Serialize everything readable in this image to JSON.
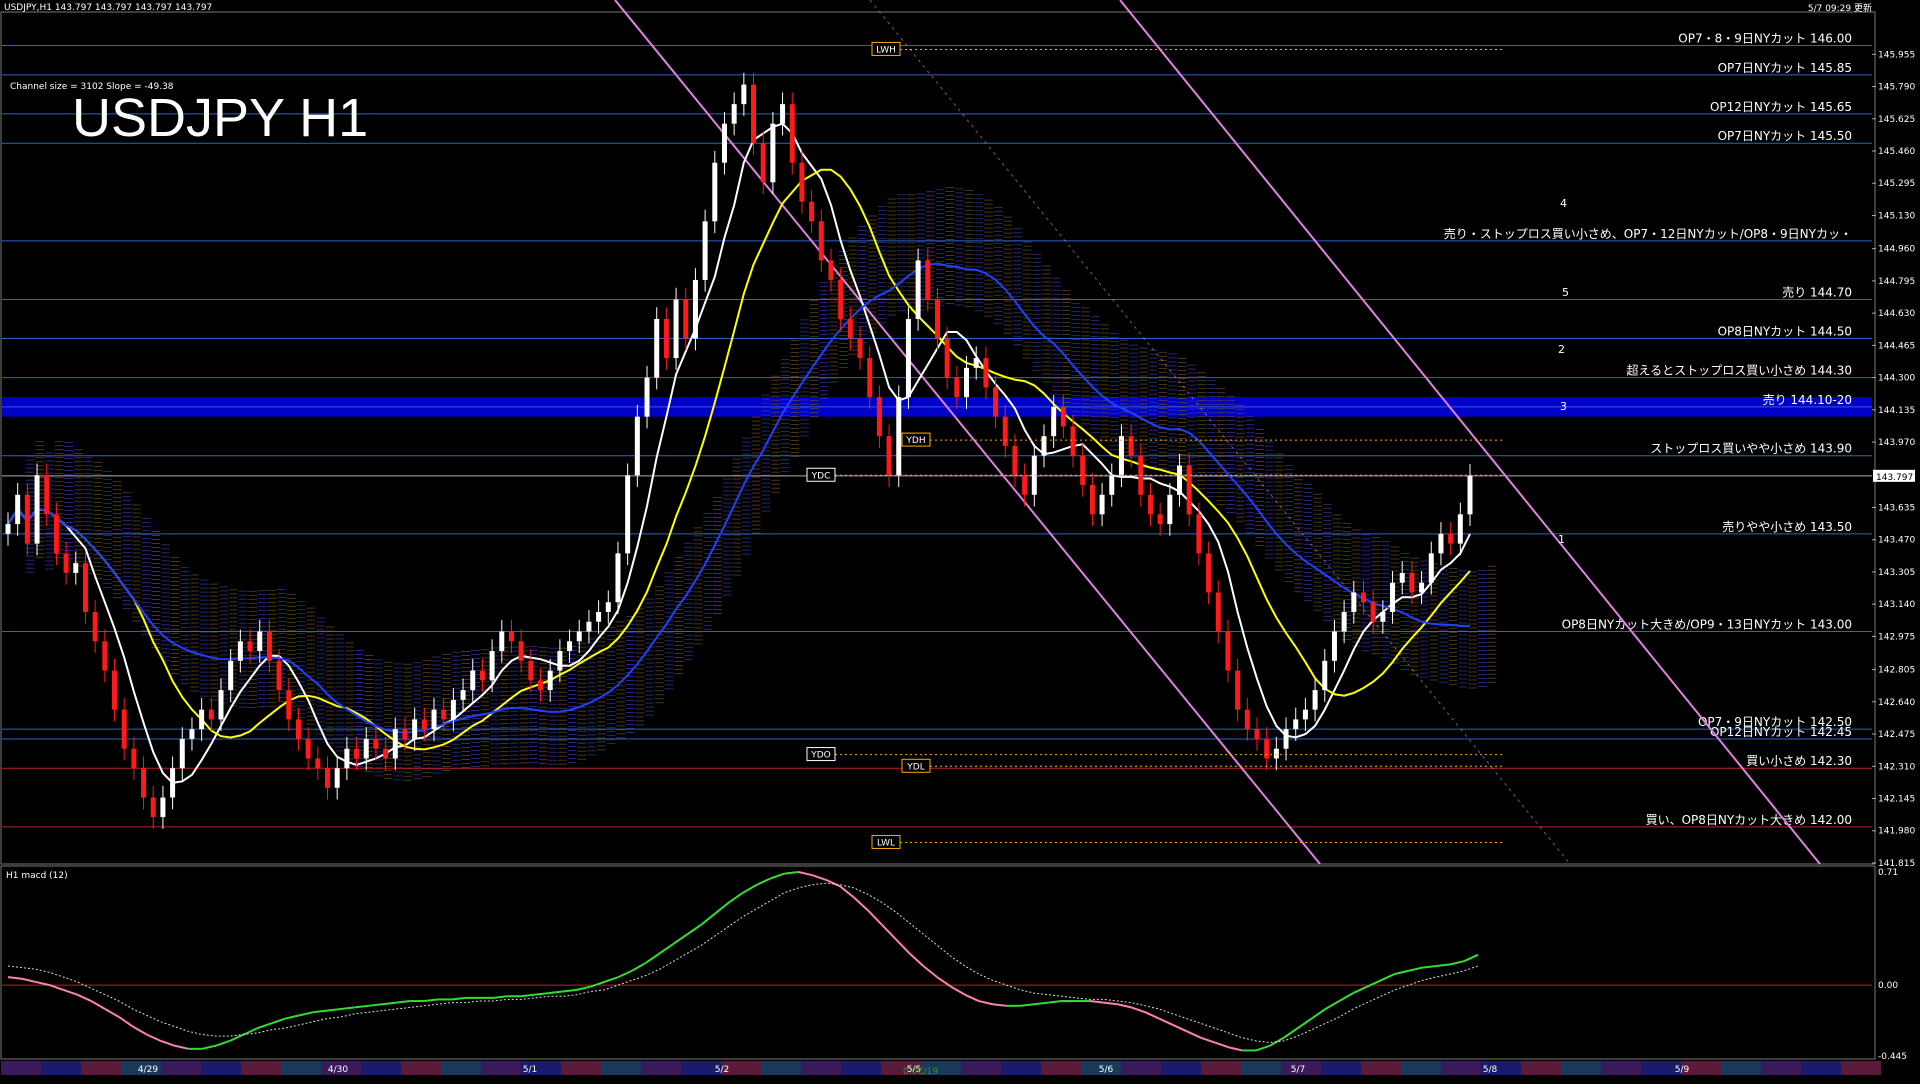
{
  "header": {
    "symbol_line": "USDJPY,H1  143.797 143.797 143.797 143.797",
    "channel_info": "Channel size = 3102 Slope = -49.38",
    "big_title": "USDJPY H1",
    "updated": "5/7 09:29 更新"
  },
  "macd_header": "H1  macd (12)",
  "footer_code": "0.0C/19",
  "colors": {
    "bg": "#000000",
    "grid_h": "#2f5fd0",
    "candle_up": "#ffffff",
    "candle_down": "#ff1a1a",
    "macd_main": "#33dd33",
    "macd_down": "#ff80b0",
    "signal": "#dddddd",
    "zone": "#0000c8",
    "channel": "#e080e0",
    "ma_white": "#ffffff",
    "ma_yellow": "#ffff00",
    "ma_blue": "#2040ff",
    "osc_green": "#22cc22"
  },
  "chart_data": {
    "type": "candlestick",
    "symbol": "USDJPY",
    "timeframe": "H1",
    "ylim": [
      141.82,
      146.1
    ],
    "last_price": "143.797",
    "y_ticks": [
      "145.955",
      "145.790",
      "145.625",
      "145.460",
      "145.295",
      "145.130",
      "144.960",
      "144.795",
      "144.630",
      "144.465",
      "144.300",
      "144.135",
      "143.970",
      "143.635",
      "143.470",
      "143.305",
      "143.140",
      "142.975",
      "142.805",
      "142.640",
      "142.475",
      "142.310",
      "142.145",
      "141.980",
      "141.815"
    ],
    "x_ticks": [
      "4/29",
      "4/30",
      "5/1",
      "5/2",
      "5/5",
      "5/6",
      "5/7",
      "5/8",
      "5/9"
    ],
    "levels": [
      {
        "price": 146.0,
        "label": "OP7・8・9日NYカット 146.00",
        "color": "#2f5fd0"
      },
      {
        "price": 145.85,
        "label": "OP7日NYカット 145.85",
        "color": "#2f5fd0"
      },
      {
        "price": 145.65,
        "label": "OP12日NYカット 145.65",
        "color": "#2f5fd0"
      },
      {
        "price": 145.5,
        "label": "OP7日NYカット 145.50",
        "color": "#2f5fd0"
      },
      {
        "price": 145.0,
        "label": "売り・ストップロス買い小さめ、OP7・12日NYカット/OP8・9日NYカッ・",
        "color": "#2f5fd0"
      },
      {
        "price": 144.7,
        "label": "売り 144.70",
        "color": "#2f5fd0"
      },
      {
        "price": 144.5,
        "label": "OP8日NYカット 144.50",
        "color": "#2f5fd0"
      },
      {
        "price": 144.3,
        "label": "超えるとストップロス買い小さめ 144.30",
        "color": "#2f5fd0"
      },
      {
        "price": 144.15,
        "label": "売り 144.10-20",
        "color": "#2f5fd0"
      },
      {
        "price": 143.9,
        "label": "ストップロス買いやや小さめ 143.90",
        "color": "#2f5fd0"
      },
      {
        "price": 143.5,
        "label": "売りやや小さめ 143.50",
        "color": "#2f5fd0"
      },
      {
        "price": 143.0,
        "label": "OP8日NYカット大きめ/OP9・13日NYカット 143.00",
        "color": "#2f5fd0"
      },
      {
        "price": 142.5,
        "label": "OP7・9日NYカット 142.50",
        "color": "#2f5fd0"
      },
      {
        "price": 142.45,
        "label": "OP12日NYカット 142.45",
        "color": "#2f5fd0"
      },
      {
        "price": 142.3,
        "label": "買い小さめ 142.30",
        "color": "#c02020"
      },
      {
        "price": 142.0,
        "label": "買い、OP8日NYカット大きめ 142.00",
        "color": "#c02020"
      }
    ],
    "markers": [
      {
        "label": "LWH",
        "price": 145.98
      },
      {
        "label": "YDH",
        "price": 143.98
      },
      {
        "label": "YDC",
        "price": 143.8
      },
      {
        "label": "YDO",
        "price": 142.37
      },
      {
        "label": "YDL",
        "price": 142.31
      },
      {
        "label": "LWL",
        "price": 141.92
      }
    ],
    "wave_labels": [
      "1",
      "2",
      "3",
      "4",
      "5"
    ],
    "candles_close": [
      143.55,
      143.7,
      143.45,
      143.8,
      143.6,
      143.4,
      143.3,
      143.35,
      143.1,
      142.95,
      142.8,
      142.6,
      142.4,
      142.3,
      142.15,
      142.05,
      142.15,
      142.3,
      142.45,
      142.5,
      142.6,
      142.55,
      142.7,
      142.85,
      142.95,
      142.9,
      143.0,
      142.85,
      142.7,
      142.55,
      142.45,
      142.35,
      142.3,
      142.2,
      142.3,
      142.4,
      142.35,
      142.45,
      142.4,
      142.35,
      142.5,
      142.45,
      142.55,
      142.5,
      142.6,
      142.55,
      142.65,
      142.7,
      142.8,
      142.75,
      142.9,
      143.0,
      142.95,
      142.85,
      142.75,
      142.7,
      142.8,
      142.9,
      142.95,
      143.0,
      143.05,
      143.1,
      143.15,
      143.4,
      143.8,
      144.1,
      144.3,
      144.6,
      144.4,
      144.7,
      144.5,
      144.8,
      145.1,
      145.4,
      145.6,
      145.7,
      145.8,
      145.5,
      145.3,
      145.6,
      145.7,
      145.4,
      145.2,
      145.1,
      144.9,
      144.8,
      144.6,
      144.5,
      144.4,
      144.2,
      144.0,
      143.8,
      144.2,
      144.6,
      144.9,
      144.7,
      144.5,
      144.3,
      144.2,
      144.35,
      144.4,
      144.25,
      144.1,
      143.95,
      143.8,
      143.7,
      143.9,
      144.0,
      144.15,
      144.05,
      143.9,
      143.75,
      143.6,
      143.7,
      143.8,
      144.0,
      143.9,
      143.7,
      143.6,
      143.55,
      143.7,
      143.85,
      143.6,
      143.4,
      143.2,
      143.0,
      142.8,
      142.6,
      142.5,
      142.45,
      142.35,
      142.4,
      142.5,
      142.55,
      142.6,
      142.7,
      142.85,
      143.0,
      143.1,
      143.2,
      143.15,
      143.05,
      143.1,
      143.25,
      143.3,
      143.2,
      143.25,
      143.4,
      143.5,
      143.45,
      143.6,
      143.797
    ],
    "macd_main": [
      0.05,
      0.04,
      0.02,
      0.0,
      -0.03,
      -0.06,
      -0.1,
      -0.15,
      -0.2,
      -0.26,
      -0.31,
      -0.35,
      -0.38,
      -0.4,
      -0.4,
      -0.38,
      -0.35,
      -0.31,
      -0.27,
      -0.24,
      -0.21,
      -0.19,
      -0.17,
      -0.16,
      -0.15,
      -0.14,
      -0.13,
      -0.12,
      -0.11,
      -0.1,
      -0.1,
      -0.09,
      -0.09,
      -0.08,
      -0.08,
      -0.08,
      -0.07,
      -0.07,
      -0.06,
      -0.05,
      -0.04,
      -0.03,
      -0.01,
      0.02,
      0.05,
      0.09,
      0.14,
      0.2,
      0.26,
      0.32,
      0.38,
      0.45,
      0.52,
      0.58,
      0.63,
      0.67,
      0.7,
      0.71,
      0.69,
      0.66,
      0.62,
      0.55,
      0.47,
      0.38,
      0.29,
      0.2,
      0.12,
      0.05,
      -0.01,
      -0.06,
      -0.1,
      -0.12,
      -0.13,
      -0.13,
      -0.12,
      -0.11,
      -0.1,
      -0.1,
      -0.1,
      -0.11,
      -0.12,
      -0.14,
      -0.17,
      -0.21,
      -0.25,
      -0.29,
      -0.33,
      -0.36,
      -0.39,
      -0.41,
      -0.41,
      -0.38,
      -0.33,
      -0.27,
      -0.21,
      -0.15,
      -0.1,
      -0.05,
      -0.01,
      0.03,
      0.07,
      0.09,
      0.11,
      0.12,
      0.13,
      0.15,
      0.19
    ],
    "macd_signal": [
      0.12,
      0.11,
      0.1,
      0.08,
      0.05,
      0.02,
      -0.02,
      -0.06,
      -0.1,
      -0.15,
      -0.19,
      -0.23,
      -0.26,
      -0.29,
      -0.31,
      -0.32,
      -0.32,
      -0.31,
      -0.3,
      -0.28,
      -0.27,
      -0.25,
      -0.23,
      -0.21,
      -0.2,
      -0.18,
      -0.17,
      -0.16,
      -0.15,
      -0.14,
      -0.13,
      -0.12,
      -0.11,
      -0.11,
      -0.1,
      -0.1,
      -0.09,
      -0.09,
      -0.08,
      -0.07,
      -0.07,
      -0.06,
      -0.04,
      -0.03,
      0.0,
      0.03,
      0.06,
      0.1,
      0.15,
      0.2,
      0.25,
      0.31,
      0.37,
      0.43,
      0.48,
      0.53,
      0.58,
      0.61,
      0.63,
      0.64,
      0.63,
      0.61,
      0.57,
      0.52,
      0.46,
      0.39,
      0.32,
      0.25,
      0.18,
      0.12,
      0.07,
      0.03,
      -0.0,
      -0.03,
      -0.05,
      -0.06,
      -0.07,
      -0.08,
      -0.09,
      -0.09,
      -0.1,
      -0.11,
      -0.13,
      -0.15,
      -0.18,
      -0.21,
      -0.24,
      -0.27,
      -0.3,
      -0.33,
      -0.35,
      -0.36,
      -0.35,
      -0.32,
      -0.28,
      -0.24,
      -0.2,
      -0.15,
      -0.11,
      -0.07,
      -0.03,
      0.0,
      0.03,
      0.05,
      0.07,
      0.09,
      0.12
    ],
    "macd_ylim": [
      -0.445,
      0.71
    ],
    "macd_ticks": [
      "0.71",
      "0.00",
      "-0.445"
    ]
  }
}
